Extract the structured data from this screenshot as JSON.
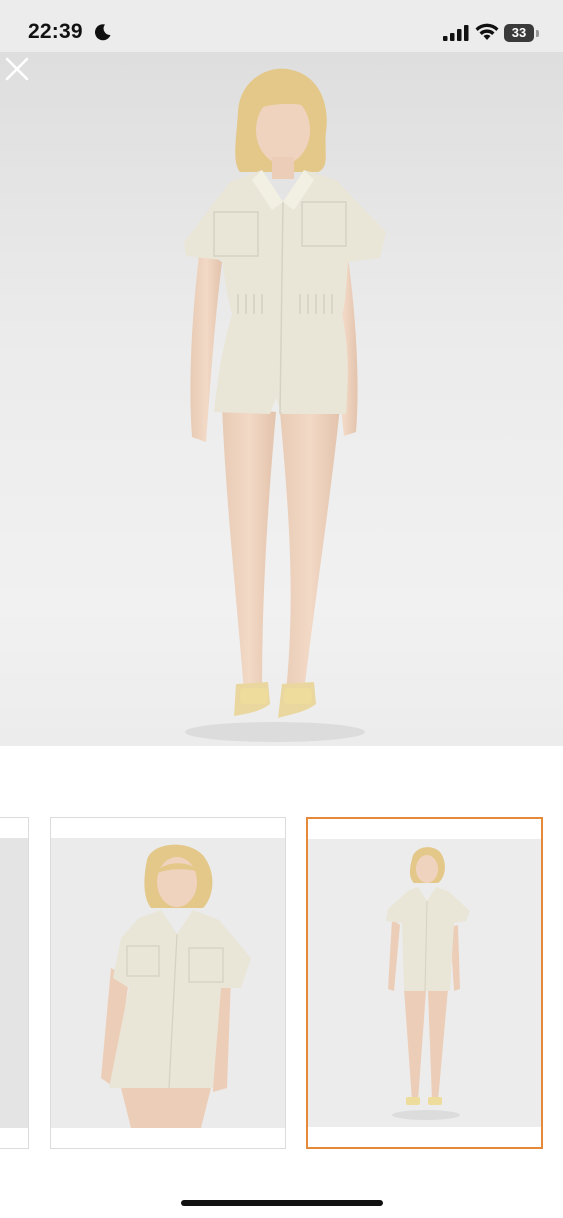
{
  "status_bar": {
    "time": "22:39",
    "battery": "33"
  },
  "icons": {
    "moon": "moon-icon",
    "signal": "cellular-signal-icon",
    "wifi": "wifi-icon",
    "battery": "battery-icon",
    "close": "close-icon"
  },
  "gallery": {
    "selected_index": 2,
    "thumbnail_count": 3
  },
  "colors": {
    "accent": "#e58a3a",
    "garment": "#e9e6d8",
    "sandal": "#eadb9a"
  }
}
